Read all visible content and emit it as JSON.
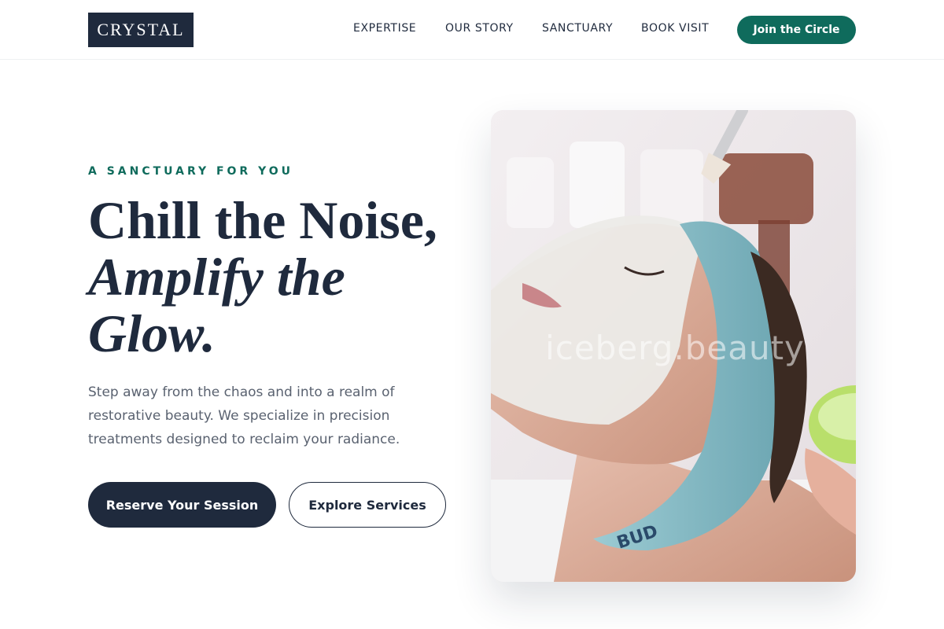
{
  "brand": {
    "logo_text": "CRYSTAL"
  },
  "nav": {
    "items": [
      {
        "label": "EXPERTISE"
      },
      {
        "label": "OUR STORY"
      },
      {
        "label": "SANCTUARY"
      },
      {
        "label": "BOOK VISIT"
      }
    ],
    "cta_label": "Join the Circle"
  },
  "hero": {
    "eyebrow": "A SANCTUARY FOR YOU",
    "headline_line1": "Chill the Noise,",
    "headline_line2": "Amplify the",
    "headline_line3": "Glow.",
    "description": "Step away from the chaos and into a realm of restorative beauty. We specialize in precision treatments designed to reclaim your radiance.",
    "primary_button": "Reserve Your Session",
    "secondary_button": "Explore Services",
    "image": {
      "watermark": "iceberg.beauty",
      "headband_text": "BUD"
    }
  },
  "colors": {
    "navy": "#1f2a3d",
    "accent_green": "#0f6b5c",
    "body_text": "#5a6270"
  }
}
